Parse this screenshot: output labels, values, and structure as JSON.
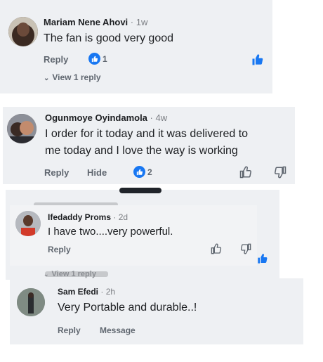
{
  "comments": [
    {
      "name": "Mariam Nene Ahovi",
      "time": "1w",
      "text": "The fan is good very good",
      "reply": "Reply",
      "likes": "1",
      "view_replies": "View 1 reply"
    },
    {
      "name": "Ogunmoye Oyindamola",
      "time": "4w",
      "text_line1": "I order for it today and it was delivered to",
      "text_line2": "me today and I love the way is working",
      "reply": "Reply",
      "hide": "Hide",
      "likes": "2"
    },
    {
      "name": "Ifedaddy Proms",
      "time": "2d",
      "text": "I have two....very powerful.",
      "reply": "Reply",
      "view_replies": "View 1 reply"
    },
    {
      "name": "Sam Efedi",
      "time": "2h",
      "text": "Very Portable and durable..!",
      "reply": "Reply",
      "message": "Message"
    }
  ],
  "colors": {
    "card": "#eef0f3",
    "like_blue": "#1877f2",
    "muted": "#606770"
  }
}
